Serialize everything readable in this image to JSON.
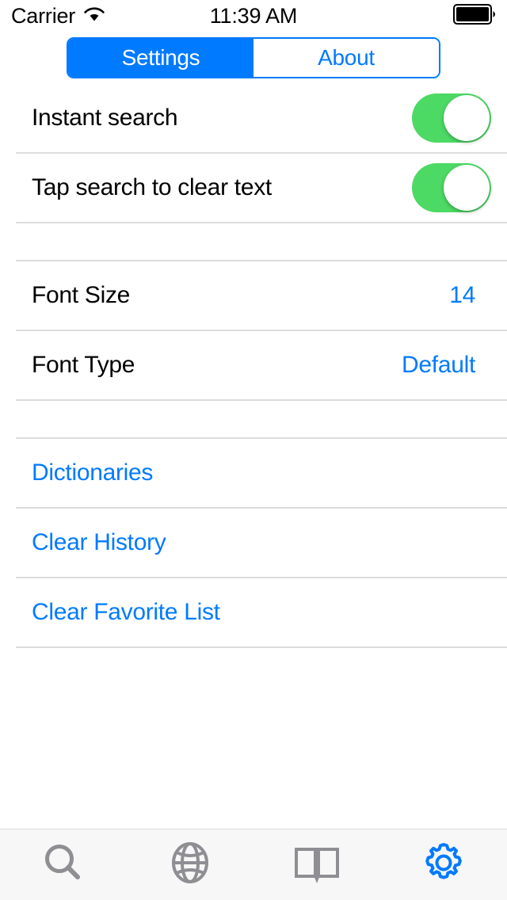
{
  "status_bar": {
    "carrier": "Carrier",
    "wifi_icon": "wifi-icon",
    "time": "11:39 AM",
    "battery_icon": "battery-full-icon"
  },
  "segmented_control": {
    "segments": [
      {
        "label": "Settings",
        "selected": true
      },
      {
        "label": "About",
        "selected": false
      }
    ]
  },
  "colors": {
    "accent_blue": "#007AFF",
    "switch_on_green": "#4CD964",
    "separator": "#dcdcdc",
    "tab_bar_background": "#f7f7f7",
    "tab_inactive": "#8e8e93",
    "text_primary": "#000000"
  },
  "sections": [
    {
      "rows": [
        {
          "type": "switch",
          "label": "Instant search",
          "value": "on"
        },
        {
          "type": "switch",
          "label": "Tap search to clear text",
          "value": "on"
        }
      ]
    },
    {
      "rows": [
        {
          "type": "value",
          "label": "Font Size",
          "value": "14"
        },
        {
          "type": "value",
          "label": "Font Type",
          "value": "Default"
        }
      ]
    },
    {
      "rows": [
        {
          "type": "link",
          "label": "Dictionaries"
        },
        {
          "type": "link",
          "label": "Clear History"
        },
        {
          "type": "link",
          "label": "Clear Favorite List"
        }
      ]
    }
  ],
  "tab_bar": {
    "items": [
      {
        "icon": "search-icon",
        "active": false
      },
      {
        "icon": "globe-icon",
        "active": false
      },
      {
        "icon": "book-icon",
        "active": false
      },
      {
        "icon": "gear-icon",
        "active": true
      }
    ]
  }
}
